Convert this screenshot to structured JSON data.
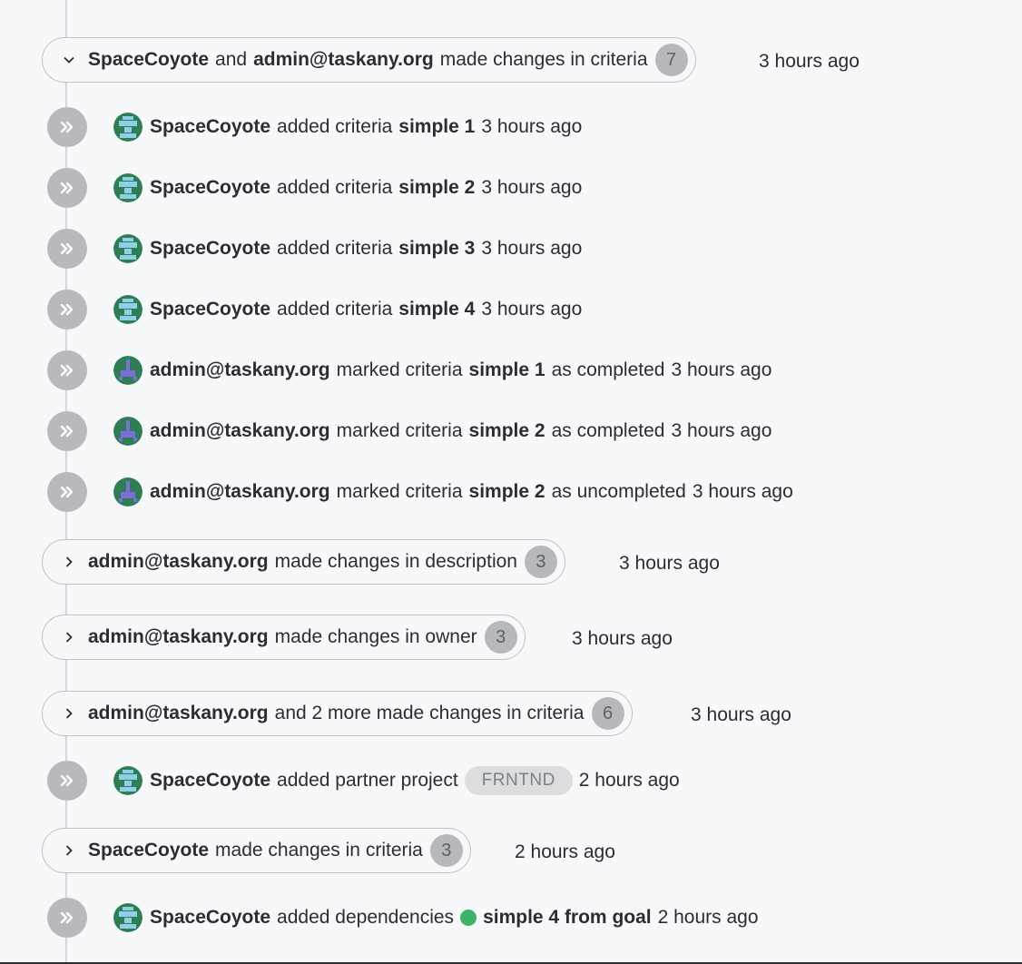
{
  "colors": {
    "background": "#f7f8fa",
    "accent_green": "#3fb26a",
    "avatar_coyote": "#2e7d55",
    "avatar_admin": "#6a5fc1"
  },
  "groups": [
    {
      "actor": "SpaceCoyote",
      "joiner": "and",
      "actor2": "admin@taskany.org",
      "text": "made changes in criteria",
      "count": "7",
      "time": "3 hours ago",
      "expanded": true
    },
    {
      "actor": "admin@taskany.org",
      "text": "made changes in description",
      "count": "3",
      "time": "3 hours ago",
      "expanded": false
    },
    {
      "actor": "admin@taskany.org",
      "text": "made changes in owner",
      "count": "3",
      "time": "3 hours ago",
      "expanded": false
    },
    {
      "actor": "admin@taskany.org",
      "text": "and 2 more made changes in criteria",
      "count": "6",
      "time": "3 hours ago",
      "expanded": false
    },
    {
      "actor": "SpaceCoyote",
      "text": "made changes in criteria",
      "count": "3",
      "time": "2 hours ago",
      "expanded": false
    }
  ],
  "events": [
    {
      "actor": "SpaceCoyote",
      "action": "added criteria",
      "target": "simple 1",
      "suffix": "",
      "time": "3 hours ago",
      "avatar": "coyote"
    },
    {
      "actor": "SpaceCoyote",
      "action": "added criteria",
      "target": "simple 2",
      "suffix": "",
      "time": "3 hours ago",
      "avatar": "coyote"
    },
    {
      "actor": "SpaceCoyote",
      "action": "added criteria",
      "target": "simple 3",
      "suffix": "",
      "time": "3 hours ago",
      "avatar": "coyote"
    },
    {
      "actor": "SpaceCoyote",
      "action": "added criteria",
      "target": "simple 4",
      "suffix": "",
      "time": "3 hours ago",
      "avatar": "coyote"
    },
    {
      "actor": "admin@taskany.org",
      "action": "marked criteria",
      "target": "simple 1",
      "suffix": "as completed",
      "time": "3 hours ago",
      "avatar": "admin"
    },
    {
      "actor": "admin@taskany.org",
      "action": "marked criteria",
      "target": "simple 2",
      "suffix": "as completed",
      "time": "3 hours ago",
      "avatar": "admin"
    },
    {
      "actor": "admin@taskany.org",
      "action": "marked criteria",
      "target": "simple 2",
      "suffix": "as uncompleted",
      "time": "3 hours ago",
      "avatar": "admin"
    },
    {
      "actor": "SpaceCoyote",
      "action": "added partner project",
      "tag": "FRNTND",
      "time": "2 hours ago",
      "avatar": "coyote"
    },
    {
      "actor": "SpaceCoyote",
      "action": "added dependencies",
      "target": "simple 4 from goal",
      "time": "2 hours ago",
      "avatar": "coyote",
      "status_icon": "green-dot-icon"
    }
  ]
}
